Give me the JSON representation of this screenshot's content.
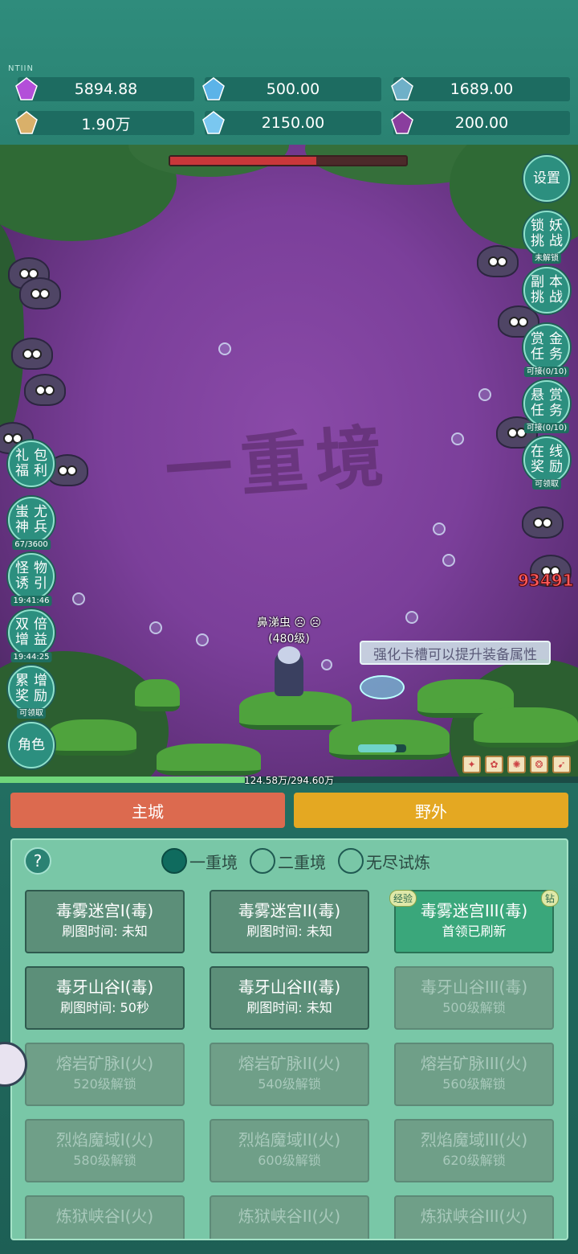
{
  "watermark_small": "NTIIN",
  "resources": [
    {
      "icon": "purple-gem-icon",
      "value": "5894.88"
    },
    {
      "icon": "blue-crystal-icon",
      "value": "500.00"
    },
    {
      "icon": "planet-orb-icon",
      "value": "1689.00"
    },
    {
      "icon": "scroll-book-icon",
      "value": "1.90万"
    },
    {
      "icon": "ice-crystal-icon",
      "value": "2150.00"
    },
    {
      "icon": "purple-orb-icon",
      "value": "200.00"
    }
  ],
  "stage_watermark": "一重境",
  "boss_hp_fraction": 0.62,
  "right_menu": [
    {
      "label": [
        "设置"
      ],
      "sub": ""
    },
    {
      "label": [
        "锁",
        "妖",
        "挑",
        "战"
      ],
      "sub": "未解锁"
    },
    {
      "label": [
        "副",
        "本",
        "挑",
        "战"
      ],
      "sub": ""
    },
    {
      "label": [
        "赏",
        "金",
        "任",
        "务"
      ],
      "sub": "可接(0/10)"
    },
    {
      "label": [
        "悬",
        "赏",
        "任",
        "务"
      ],
      "sub": "可接(0/10)"
    },
    {
      "label": [
        "在",
        "线",
        "奖",
        "励"
      ],
      "sub": "可领取"
    }
  ],
  "left_menu": [
    {
      "label": [
        "礼",
        "包",
        "福",
        "利"
      ],
      "sub": ""
    },
    {
      "label": [
        "蚩",
        "尤",
        "神",
        "兵"
      ],
      "sub": "67/3600"
    },
    {
      "label": [
        "怪",
        "物",
        "诱",
        "引"
      ],
      "sub": "19:41:46"
    },
    {
      "label": [
        "双",
        "倍",
        "增",
        "益"
      ],
      "sub": "19:44:25"
    },
    {
      "label": [
        "累",
        "增",
        "奖",
        "励"
      ],
      "sub": "可领取"
    },
    {
      "label": [
        "角色"
      ],
      "sub": ""
    }
  ],
  "target_name": "鼻涕虫",
  "target_level": "(480级)",
  "tip": "强化卡槽可以提升装备属性",
  "damage": "93491",
  "exp_text": "124.58万/294.60万",
  "exp_fraction": 0.423,
  "tabs": {
    "main_city": "主城",
    "wild": "野外"
  },
  "tab_colors": {
    "main_city": "#dc6a4f",
    "wild": "#e4a822"
  },
  "help": "?",
  "realms": [
    {
      "label": "一重境",
      "selected": true
    },
    {
      "label": "二重境",
      "selected": false
    },
    {
      "label": "无尽试炼",
      "selected": false
    }
  ],
  "maps": [
    {
      "title": "毒雾迷宫I(毒)",
      "status": "刷图时间: 未知",
      "state": "open"
    },
    {
      "title": "毒雾迷宫II(毒)",
      "status": "刷图时间: 未知",
      "state": "open"
    },
    {
      "title": "毒雾迷宫III(毒)",
      "status": "首领已刷新",
      "state": "active",
      "badge_left": "经验",
      "badge_right": "钻"
    },
    {
      "title": "毒牙山谷I(毒)",
      "status": "刷图时间: 50秒",
      "state": "open"
    },
    {
      "title": "毒牙山谷II(毒)",
      "status": "刷图时间: 未知",
      "state": "open"
    },
    {
      "title": "毒牙山谷III(毒)",
      "status": "500级解锁",
      "state": "locked"
    },
    {
      "title": "熔岩矿脉I(火)",
      "status": "520级解锁",
      "state": "locked"
    },
    {
      "title": "熔岩矿脉II(火)",
      "status": "540级解锁",
      "state": "locked"
    },
    {
      "title": "熔岩矿脉III(火)",
      "status": "560级解锁",
      "state": "locked"
    },
    {
      "title": "烈焰魔域I(火)",
      "status": "580级解锁",
      "state": "locked"
    },
    {
      "title": "烈焰魔域II(火)",
      "status": "600级解锁",
      "state": "locked"
    },
    {
      "title": "烈焰魔域III(火)",
      "status": "620级解锁",
      "state": "locked"
    },
    {
      "title": "炼狱峡谷I(火)",
      "status": "",
      "state": "locked"
    },
    {
      "title": "炼狱峡谷II(火)",
      "status": "",
      "state": "locked"
    },
    {
      "title": "炼狱峡谷III(火)",
      "status": "",
      "state": "locked"
    }
  ]
}
